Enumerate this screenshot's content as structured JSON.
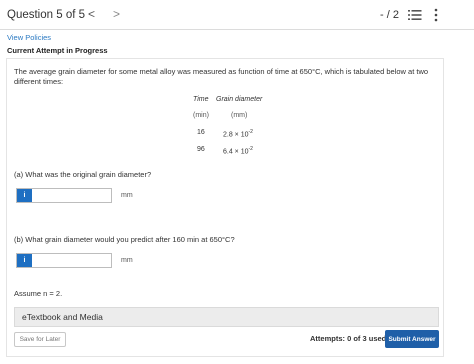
{
  "header": {
    "question_label": "Question 5 of 5",
    "prev_symbol": "<",
    "next_symbol": ">",
    "score": "- / 2"
  },
  "policies_link": "View Policies",
  "attempt_status": "Current Attempt in Progress",
  "problem_text": "The average grain diameter for some metal alloy was measured as function of time at 650°C, which is tabulated below at two different times:",
  "table": {
    "headers": [
      "Time",
      "Grain diameter"
    ],
    "units": [
      "(min)",
      "(mm)"
    ],
    "rows": [
      {
        "time": "16",
        "mantissa": "2.8 × 10",
        "exponent": "-2"
      },
      {
        "time": "96",
        "mantissa": "6.4 × 10",
        "exponent": "-2"
      }
    ]
  },
  "part_a": {
    "prompt": "(a) What was the original grain diameter?",
    "info": "i",
    "value": "",
    "unit": "mm"
  },
  "part_b": {
    "prompt": "(b) What grain diameter would you predict after 160 min at 650°C?",
    "info": "i",
    "value": "",
    "unit": "mm"
  },
  "assumption": "Assume n = 2.",
  "etextbook": "eTextbook and Media",
  "footer": {
    "save_label": "Save for Later",
    "attempts": "Attempts: 0 of 3 used",
    "submit_label": "Submit Answer"
  },
  "colors": {
    "accent": "#1e6fc2",
    "submit": "#1f5fa8",
    "link": "#2a79c2"
  },
  "icons": [
    "list-icon",
    "more-vertical-icon"
  ]
}
